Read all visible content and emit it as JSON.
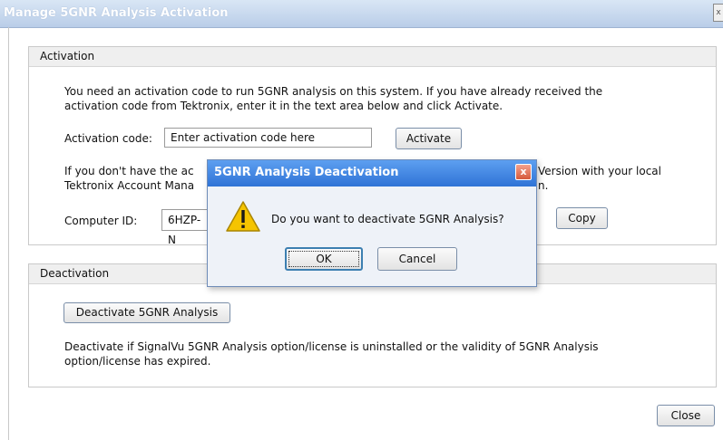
{
  "window": {
    "title": "Manage 5GNR Analysis Activation",
    "close_glyph": "x"
  },
  "activation": {
    "header": "Activation",
    "intro_line1": "You need an activation code to run 5GNR analysis on this system. If you have already received the",
    "intro_line2": "activation code from Tektronix, enter it in the text area below and click Activate.",
    "code_label": "Activation code:",
    "code_placeholder": "Enter activation code here",
    "activate_label": "Activate",
    "nocode_line1_left": "If you don't have the ac",
    "nocode_line1_right": "Version with your local",
    "nocode_line2_left": "Tektronix Account Mana",
    "nocode_line2_right": "n.",
    "computer_id_label": "Computer ID:",
    "computer_id_value": "6HZP-N",
    "copy_label": "Copy"
  },
  "deactivation": {
    "header": "Deactivation",
    "deactivate_label": "Deactivate 5GNR Analysis",
    "note_line1": "Deactivate if SignalVu 5GNR Analysis option/license is uninstalled or the validity of 5GNR Analysis",
    "note_line2": "option/license has expired."
  },
  "footer": {
    "close_label": "Close"
  },
  "dialog": {
    "title": "5GNR Analysis Deactivation",
    "close_glyph": "x",
    "message": "Do you want to deactivate 5GNR Analysis?",
    "ok_label": "OK",
    "cancel_label": "Cancel",
    "icon": "warning-icon"
  },
  "colors": {
    "dialog_title": "#2f73d6",
    "warning": "#f5c400"
  }
}
